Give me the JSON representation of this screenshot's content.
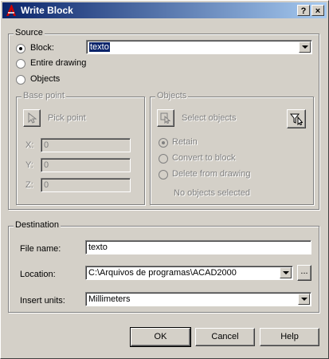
{
  "window": {
    "title": "Write Block",
    "help_glyph": "?",
    "close_glyph": "×"
  },
  "source": {
    "legend": "Source",
    "block_label": "Block:",
    "block_selected": "texto",
    "entire_drawing_label": "Entire drawing",
    "objects_label": "Objects",
    "selected_option": "Block"
  },
  "base_point": {
    "legend": "Base point",
    "pick_point_label": "Pick point",
    "x_label": "X:",
    "x_value": "0",
    "y_label": "Y:",
    "y_value": "0",
    "z_label": "Z:",
    "z_value": "0"
  },
  "objects": {
    "legend": "Objects",
    "select_objects_label": "Select objects",
    "retain_label": "Retain",
    "convert_label": "Convert to block",
    "delete_label": "Delete from drawing",
    "status": "No objects selected"
  },
  "destination": {
    "legend": "Destination",
    "file_name_label": "File name:",
    "file_name_value": "texto",
    "location_label": "Location:",
    "location_value": "C:\\Arquivos de programas\\ACAD2000",
    "browse_label": "...",
    "insert_units_label": "Insert units:",
    "insert_units_value": "Millimeters"
  },
  "buttons": {
    "ok": "OK",
    "cancel": "Cancel",
    "help": "Help"
  },
  "colors": {
    "face": "#d4d0c8",
    "title_start": "#0a246a",
    "title_end": "#a6caf0",
    "selection": "#0a246a"
  }
}
